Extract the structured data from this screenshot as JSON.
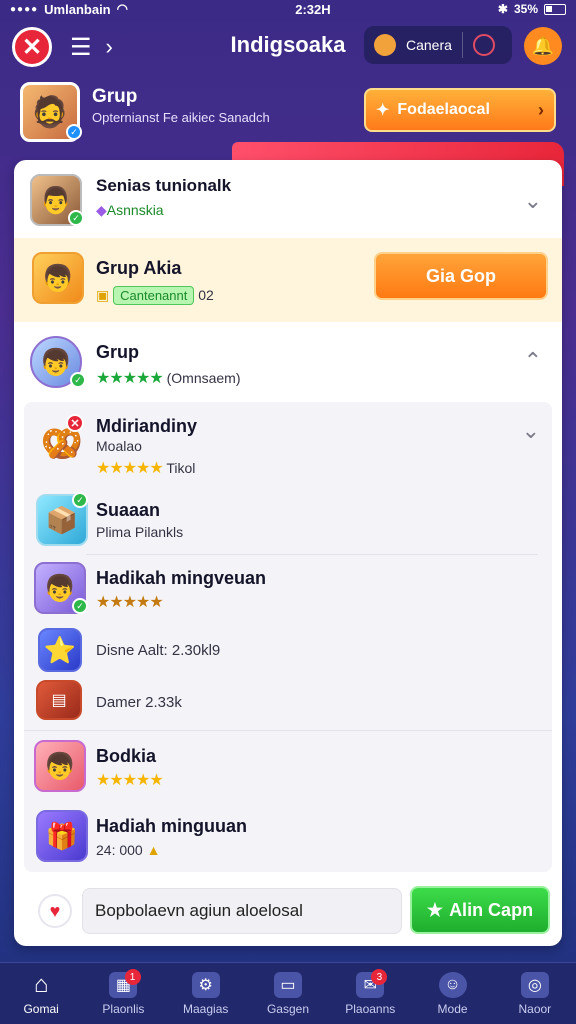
{
  "status_bar": {
    "carrier": "Umlanbain",
    "time": "2:32H",
    "battery": "35%"
  },
  "nav": {
    "title": "Indigsoaka",
    "camera_label": "Canera"
  },
  "profile": {
    "name": "Grup",
    "subtitle": "Opternianst Fe aikiec Sanadch",
    "action_label": "Fodaelaocal"
  },
  "list": {
    "row1": {
      "title": "Senias tunionalk",
      "sub": "Asnnskia"
    },
    "row2": {
      "title": "Grup Akia",
      "tag": "Cantenannt",
      "count": "02",
      "button": "Gia Gop"
    },
    "row3": {
      "title": "Grup",
      "sub": "(Omnsaem)",
      "stars": "★★★★★"
    },
    "row4": {
      "title": "Mdiriandiny",
      "sub": "Moalao",
      "stars": "★★★★★",
      "extra": "Tikol"
    },
    "row5": {
      "title": "Suaaan",
      "sub": "Plima Pilankls"
    },
    "row6": {
      "title": "Hadikah mingveuan",
      "stars": "★★★★★"
    },
    "row7": {
      "text": "Disne Aalt: 2.30kl9"
    },
    "row8": {
      "text": "Damer 2.33k"
    },
    "row9": {
      "title": "Bodkia",
      "stars": "★★★★★"
    },
    "row10": {
      "title": "Hadiah minguuan",
      "sub": "24: 000"
    }
  },
  "bottom": {
    "input_value": "Bopbolaevn agiun aloelosal",
    "button_label": "Alin Capn"
  },
  "tabs": [
    {
      "label": "Gomai",
      "icon": "home-icon"
    },
    {
      "label": "Plaonlis",
      "icon": "cards-icon",
      "badge": "1"
    },
    {
      "label": "Maagias",
      "icon": "gear-icon"
    },
    {
      "label": "Gasgen",
      "icon": "device-icon"
    },
    {
      "label": "Plaoanns",
      "icon": "chat-icon",
      "badge": "3"
    },
    {
      "label": "Mode",
      "icon": "smile-icon"
    },
    {
      "label": "Naoor",
      "icon": "camera-icon"
    }
  ],
  "colors": {
    "accent_orange": "#ff7a12",
    "accent_green": "#1fae2e",
    "accent_red": "#e8263a",
    "tab_bar": "#21286b"
  }
}
